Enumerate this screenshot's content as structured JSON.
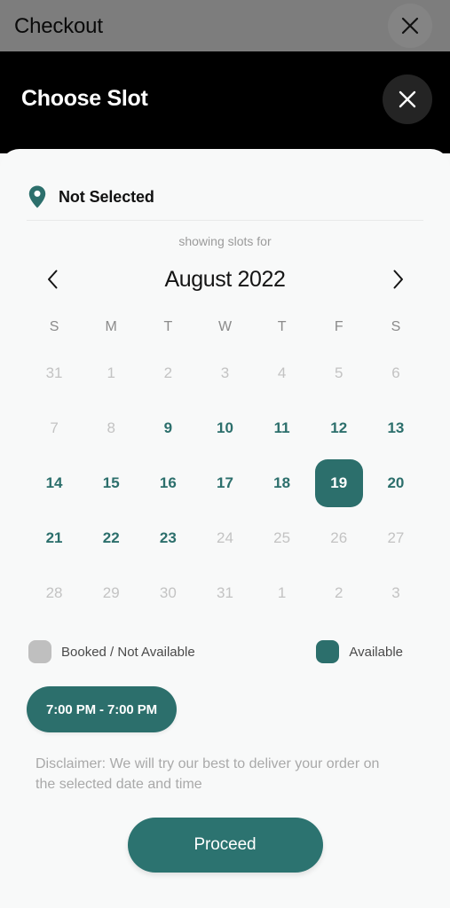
{
  "background_bar": {
    "title": "Checkout",
    "close_icon": "close-icon"
  },
  "modal": {
    "title": "Choose Slot",
    "close_icon": "close-icon"
  },
  "location": {
    "icon": "map-pin-icon",
    "label": "Not Selected"
  },
  "showing_for_label": "showing slots for",
  "calendar": {
    "prev_icon": "chevron-left-icon",
    "next_icon": "chevron-right-icon",
    "month_label": "August 2022",
    "weekdays": [
      "S",
      "M",
      "T",
      "W",
      "T",
      "F",
      "S"
    ],
    "weeks": [
      [
        {
          "day": "31",
          "state": "muted"
        },
        {
          "day": "1",
          "state": "muted"
        },
        {
          "day": "2",
          "state": "muted"
        },
        {
          "day": "3",
          "state": "muted"
        },
        {
          "day": "4",
          "state": "muted"
        },
        {
          "day": "5",
          "state": "muted"
        },
        {
          "day": "6",
          "state": "muted"
        }
      ],
      [
        {
          "day": "7",
          "state": "muted"
        },
        {
          "day": "8",
          "state": "muted"
        },
        {
          "day": "9",
          "state": "available"
        },
        {
          "day": "10",
          "state": "available"
        },
        {
          "day": "11",
          "state": "available"
        },
        {
          "day": "12",
          "state": "available"
        },
        {
          "day": "13",
          "state": "available"
        }
      ],
      [
        {
          "day": "14",
          "state": "available"
        },
        {
          "day": "15",
          "state": "available"
        },
        {
          "day": "16",
          "state": "available"
        },
        {
          "day": "17",
          "state": "available"
        },
        {
          "day": "18",
          "state": "available"
        },
        {
          "day": "19",
          "state": "selected"
        },
        {
          "day": "20",
          "state": "available"
        }
      ],
      [
        {
          "day": "21",
          "state": "available"
        },
        {
          "day": "22",
          "state": "available"
        },
        {
          "day": "23",
          "state": "available"
        },
        {
          "day": "24",
          "state": "muted"
        },
        {
          "day": "25",
          "state": "muted"
        },
        {
          "day": "26",
          "state": "muted"
        },
        {
          "day": "27",
          "state": "muted"
        }
      ],
      [
        {
          "day": "28",
          "state": "muted"
        },
        {
          "day": "29",
          "state": "muted"
        },
        {
          "day": "30",
          "state": "muted"
        },
        {
          "day": "31",
          "state": "muted"
        },
        {
          "day": "1",
          "state": "muted"
        },
        {
          "day": "2",
          "state": "muted"
        },
        {
          "day": "3",
          "state": "muted"
        }
      ]
    ]
  },
  "legend": {
    "booked_label": "Booked / Not Available",
    "available_label": "Available"
  },
  "slots": [
    {
      "label": "7:00 PM - 7:00 PM",
      "selected": true
    }
  ],
  "disclaimer": "Disclaimer: We will try our best to deliver your order on the selected date and time",
  "proceed": {
    "label": "Proceed"
  },
  "colors": {
    "teal": "#2c6f6c",
    "teal_button": "#2c7370",
    "muted_gray": "#c3c3c3",
    "booked_swatch": "#bfbfbf",
    "sheet_bg": "#f8f9f9",
    "header_black": "#000000",
    "scrim_gray": "#7d7d7d"
  }
}
